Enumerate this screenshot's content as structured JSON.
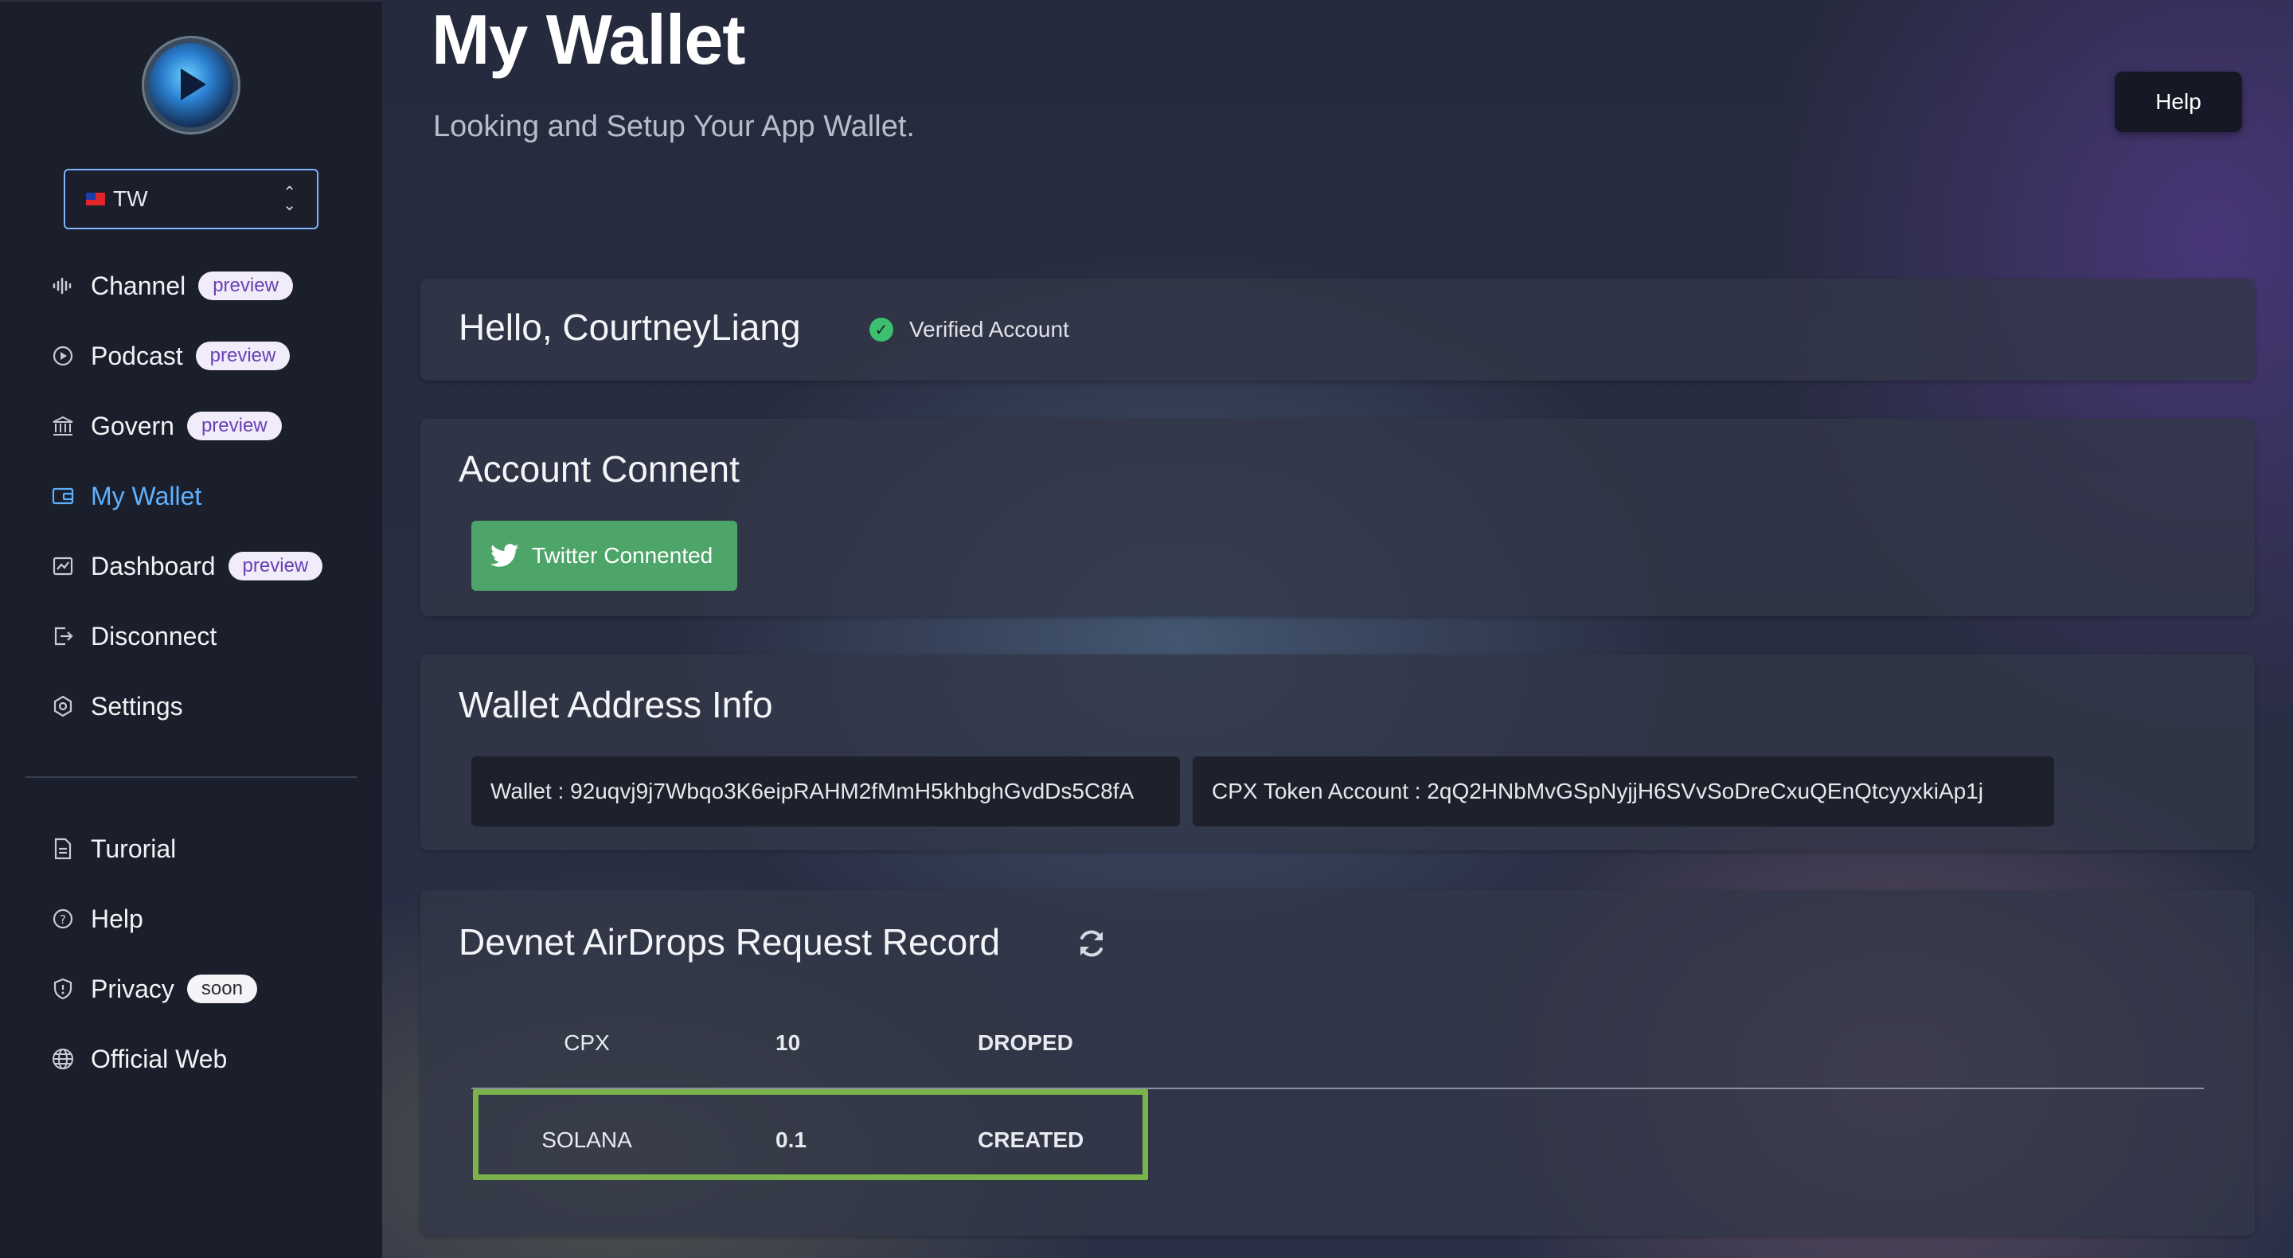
{
  "sidebar": {
    "language": {
      "code": "TW",
      "flag": "taiwan-flag"
    },
    "nav": [
      {
        "label": "Channel",
        "icon": "audio-wave-icon",
        "badge": "preview"
      },
      {
        "label": "Podcast",
        "icon": "play-circle-icon",
        "badge": "preview"
      },
      {
        "label": "Govern",
        "icon": "bank-icon",
        "badge": "preview"
      },
      {
        "label": "My Wallet",
        "icon": "wallet-icon",
        "badge": "",
        "active": true
      },
      {
        "label": "Dashboard",
        "icon": "line-chart-icon",
        "badge": "preview"
      },
      {
        "label": "Disconnect",
        "icon": "logout-icon",
        "badge": ""
      },
      {
        "label": "Settings",
        "icon": "gear-icon",
        "badge": ""
      }
    ],
    "secondary": [
      {
        "label": "Turorial",
        "icon": "document-icon",
        "badge": ""
      },
      {
        "label": "Help",
        "icon": "question-circle-icon",
        "badge": ""
      },
      {
        "label": "Privacy",
        "icon": "shield-icon",
        "badge": "soon"
      },
      {
        "label": "Official Web",
        "icon": "globe-icon",
        "badge": ""
      }
    ]
  },
  "header": {
    "title": "My Wallet",
    "subtitle": "Looking and Setup Your App Wallet.",
    "help_label": "Help"
  },
  "greeting": {
    "text": "Hello, CourtneyLiang",
    "verified_label": "Verified Account"
  },
  "account": {
    "title": "Account Connent",
    "twitter_label": "Twitter Connented"
  },
  "wallet_info": {
    "title": "Wallet Address Info",
    "wallet": "Wallet : 92uqvj9j7Wbqo3K6eipRAHM2fMmH5khbghGvdDs5C8fA",
    "token_account": "CPX Token Account : 2qQ2HNbMvGSpNyjjH6SVvSoDreCxuQEnQtcyyxkiAp1j"
  },
  "airdrops": {
    "title": "Devnet AirDrops Request Record",
    "rows": [
      {
        "token": "CPX",
        "amount": "10",
        "status": "DROPED"
      },
      {
        "token": "SOLANA",
        "amount": "0.1",
        "status": "CREATED"
      }
    ]
  },
  "colors": {
    "accent": "#5fb1ff",
    "badge_bg": "#f0ecfa",
    "badge_text": "#6a3fb5",
    "twitter_button": "#4da56a",
    "verified": "#3cbf6f",
    "highlight": "#7ab34a"
  }
}
